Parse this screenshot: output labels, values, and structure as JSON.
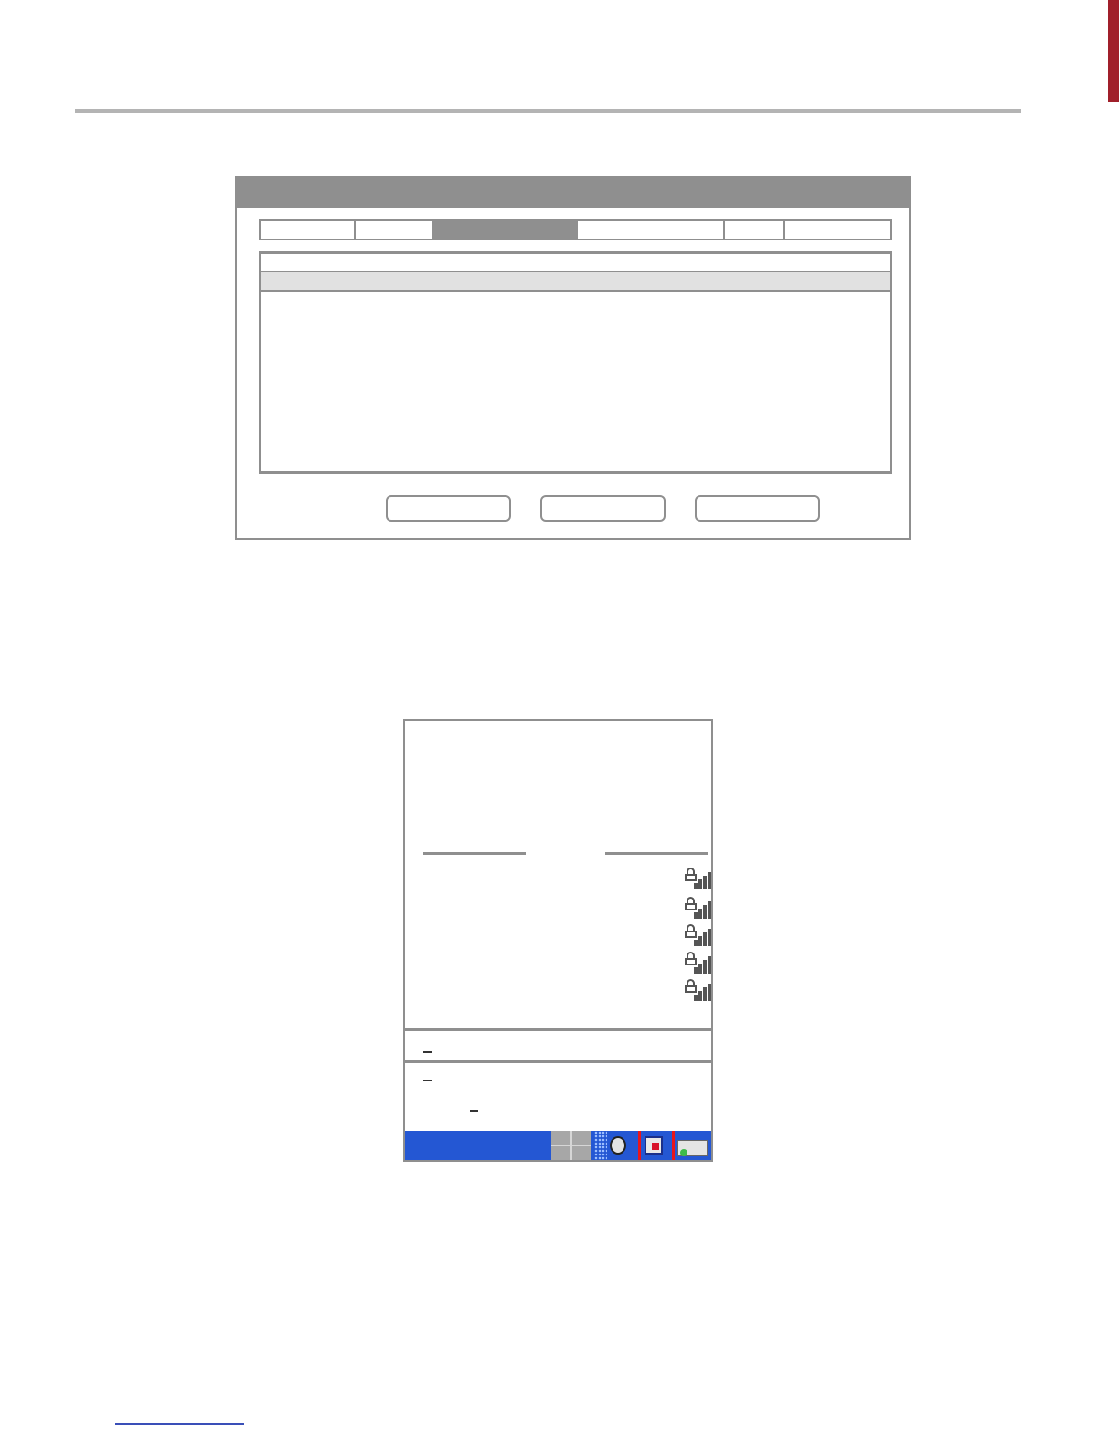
{
  "dialog": {
    "title": "",
    "tabs": [
      {
        "label": ""
      },
      {
        "label": ""
      },
      {
        "label": "",
        "active": true
      },
      {
        "label": ""
      },
      {
        "label": ""
      },
      {
        "label": ""
      }
    ],
    "list_header": "",
    "buttons": [
      {
        "label": ""
      },
      {
        "label": ""
      },
      {
        "label": ""
      }
    ]
  },
  "device": {
    "networks": [
      {
        "icon": "lock-signal-icon"
      },
      {
        "icon": "lock-signal-icon"
      },
      {
        "icon": "lock-signal-icon"
      },
      {
        "icon": "lock-signal-icon"
      },
      {
        "icon": "lock-signal-icon"
      }
    ],
    "taskbar_color": "#2457d3",
    "tray_icons": [
      "start-grid-icon",
      "keyboard-icon",
      "speaker-icon",
      "network-icon",
      "battery-icon"
    ]
  },
  "colors": {
    "frame_gray": "#8f8f8f",
    "side_tab": "#a01f2a",
    "footer_link": "#3a4fb8",
    "tray_separator": "#e8151b"
  }
}
